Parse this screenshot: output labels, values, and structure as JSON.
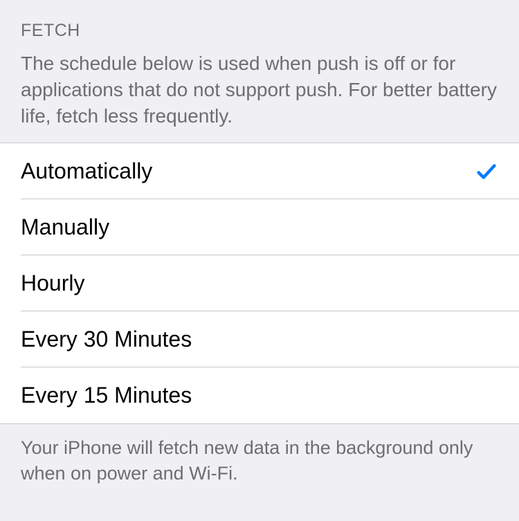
{
  "section": {
    "header": "FETCH",
    "description": "The schedule below is used when push is off or for applications that do not support push. For better battery life, fetch less frequently.",
    "footer": "Your iPhone will fetch new data in the background only when on power and Wi-Fi."
  },
  "options": [
    {
      "label": "Automatically",
      "selected": true
    },
    {
      "label": "Manually",
      "selected": false
    },
    {
      "label": "Hourly",
      "selected": false
    },
    {
      "label": "Every 30 Minutes",
      "selected": false
    },
    {
      "label": "Every 15 Minutes",
      "selected": false
    }
  ],
  "colors": {
    "accent": "#007aff",
    "background": "#efeff4",
    "text_secondary": "#6d6d72"
  }
}
